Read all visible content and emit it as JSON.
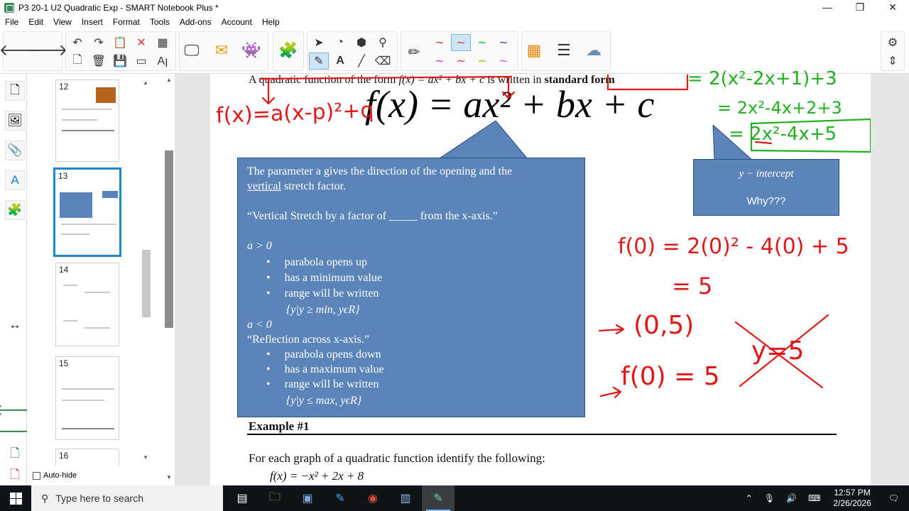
{
  "window": {
    "title": "P3 20-1 U2 Quadratic Exp - SMART Notebook Plus *",
    "controls": [
      "—",
      "❐",
      "✕"
    ]
  },
  "menu": [
    "File",
    "Edit",
    "View",
    "Insert",
    "Format",
    "Tools",
    "Add-ons",
    "Account",
    "Help"
  ],
  "sorter": {
    "pages": [
      "12",
      "13",
      "14",
      "15",
      "16"
    ],
    "selected": "13",
    "autohide_label": "Auto-hide"
  },
  "page": {
    "intro": "A quadratic function of the form",
    "intro_formula": "f(x) = ax² + bx + c",
    "intro_suffix": "is written in",
    "intro_bold": "standard form",
    "big_equation": "f(x) = ax² + bx + c",
    "box": {
      "line1": "The parameter a gives the direction of the opening and the",
      "line2_u": "vertical",
      "line2_rest": "stretch factor.",
      "line3": "“Vertical Stretch by a factor of _____ from the x-axis.”",
      "cond_pos": "a > 0",
      "pos_items": [
        "parabola opens up",
        "has a minimum value",
        "range will be written"
      ],
      "pos_set": "{y|y ≥ min, yϵR}",
      "cond_neg": "a < 0",
      "reflection": "“Reflection across x-axis.”",
      "neg_items": [
        "parabola opens down",
        "has a maximum value",
        "range will be written"
      ],
      "neg_set": "{y|y ≤ max, yϵR}"
    },
    "yint_box": {
      "title": "y − intercept",
      "why": "Why???"
    },
    "example_heading": "Example #1",
    "example_text": "For each graph of a quadratic function identify the following:",
    "example_formula": "f(x) = −x² + 2x + 8"
  },
  "ink": {
    "vertex_form": "f(x)=a(x-p)²+q",
    "green_1": "= 2(x²-2x+1)+3",
    "green_2": "= 2x²-4x+2+3",
    "green_3": "= 2x²-4x+5",
    "red_1": "f(0) = 2(0)² - 4(0) + 5",
    "red_2": "= 5",
    "red_3": "(0,5)",
    "red_4": "f(0) = 5",
    "red_crossed": "y=5"
  },
  "taskbar": {
    "search_placeholder": "Type here to search",
    "time": "12:57 PM",
    "date": "2/26/2026"
  }
}
